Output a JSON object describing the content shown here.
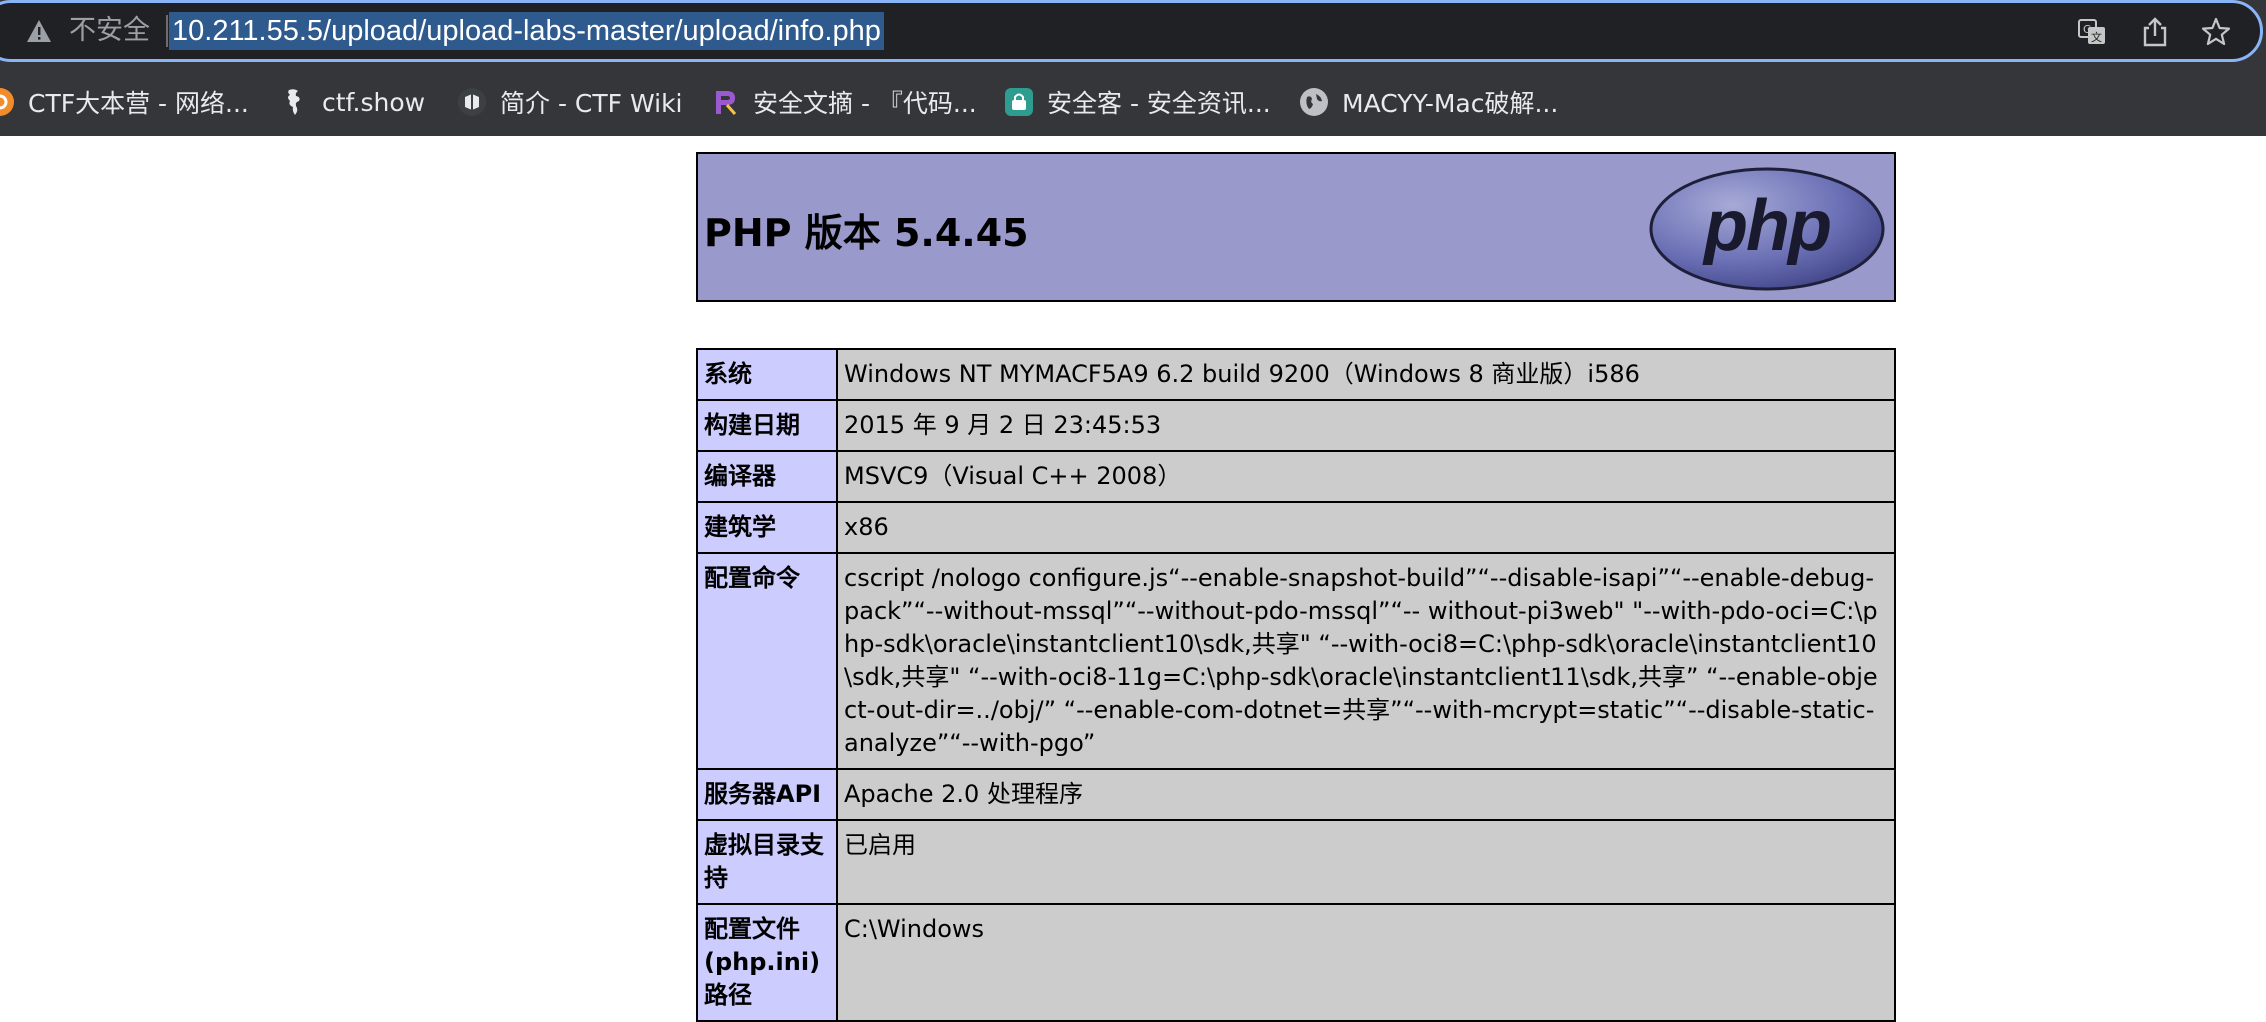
{
  "browser": {
    "insecure_label": "不安全",
    "url": "10.211.55.5/upload/upload-labs-master/upload/info.php",
    "bookmarks": [
      {
        "label": "CTF大本营 - 网络...",
        "icon": "ctf-orange-icon",
        "color": "#f28c28"
      },
      {
        "label": "ctf.show",
        "icon": "ctfshow-figure-icon",
        "color": "#202124"
      },
      {
        "label": "简介 - CTF Wiki",
        "icon": "ctf-wiki-icon",
        "color": "#5f6368"
      },
      {
        "label": "安全文摘 - 『代码...",
        "icon": "anquan-wenzhai-icon",
        "color": "#7b3fa0"
      },
      {
        "label": "安全客 - 安全资讯...",
        "icon": "anquanke-icon",
        "color": "#2e9d8f"
      },
      {
        "label": "MACYY-Mac破解...",
        "icon": "globe-icon",
        "color": "#5f6368"
      }
    ]
  },
  "phpinfo": {
    "title": "PHP 版本 5.4.45",
    "logo_text": "php",
    "rows": [
      {
        "key": "系统",
        "value": "Windows NT MYMACF5A9 6.2 build 9200（Windows 8 商业版）i586"
      },
      {
        "key": "构建日期",
        "value": "2015 年 9 月 2 日 23:45:53"
      },
      {
        "key": "编译器",
        "value": "MSVC9（Visual C++ 2008）"
      },
      {
        "key": "建筑学",
        "value": "x86"
      },
      {
        "key": "配置命令",
        "value": "cscript /nologo configure.js“--enable-snapshot-build”“--disable-isapi”“--enable-debug-pack”“--without-mssql”“--without-pdo-mssql”“-- without-pi3web\" \"--with-pdo-oci=C:\\php-sdk\\oracle\\instantclient10\\sdk,共享\" “--with-oci8=C:\\php-sdk\\oracle\\instantclient10\\sdk,共享\" “--with-oci8-11g=C:\\php-sdk\\oracle\\instantclient11\\sdk,共享” “--enable-object-out-dir=../obj/” “--enable-com-dotnet=共享”“--with-mcrypt=static”“--disable-static-analyze”“--with-pgo”"
      },
      {
        "key": "服务器API",
        "value": "Apache 2.0 处理程序"
      },
      {
        "key": "虚拟目录支持",
        "value": "已启用"
      },
      {
        "key": "配置文件 (php.ini) 路径",
        "value": "C:\\Windows"
      }
    ]
  },
  "colors": {
    "header_bg": "#9999cc",
    "key_bg": "#ccccff",
    "value_bg": "#cccccc",
    "chrome_bg": "#35363a",
    "url_highlight": "#2f5a8e"
  }
}
